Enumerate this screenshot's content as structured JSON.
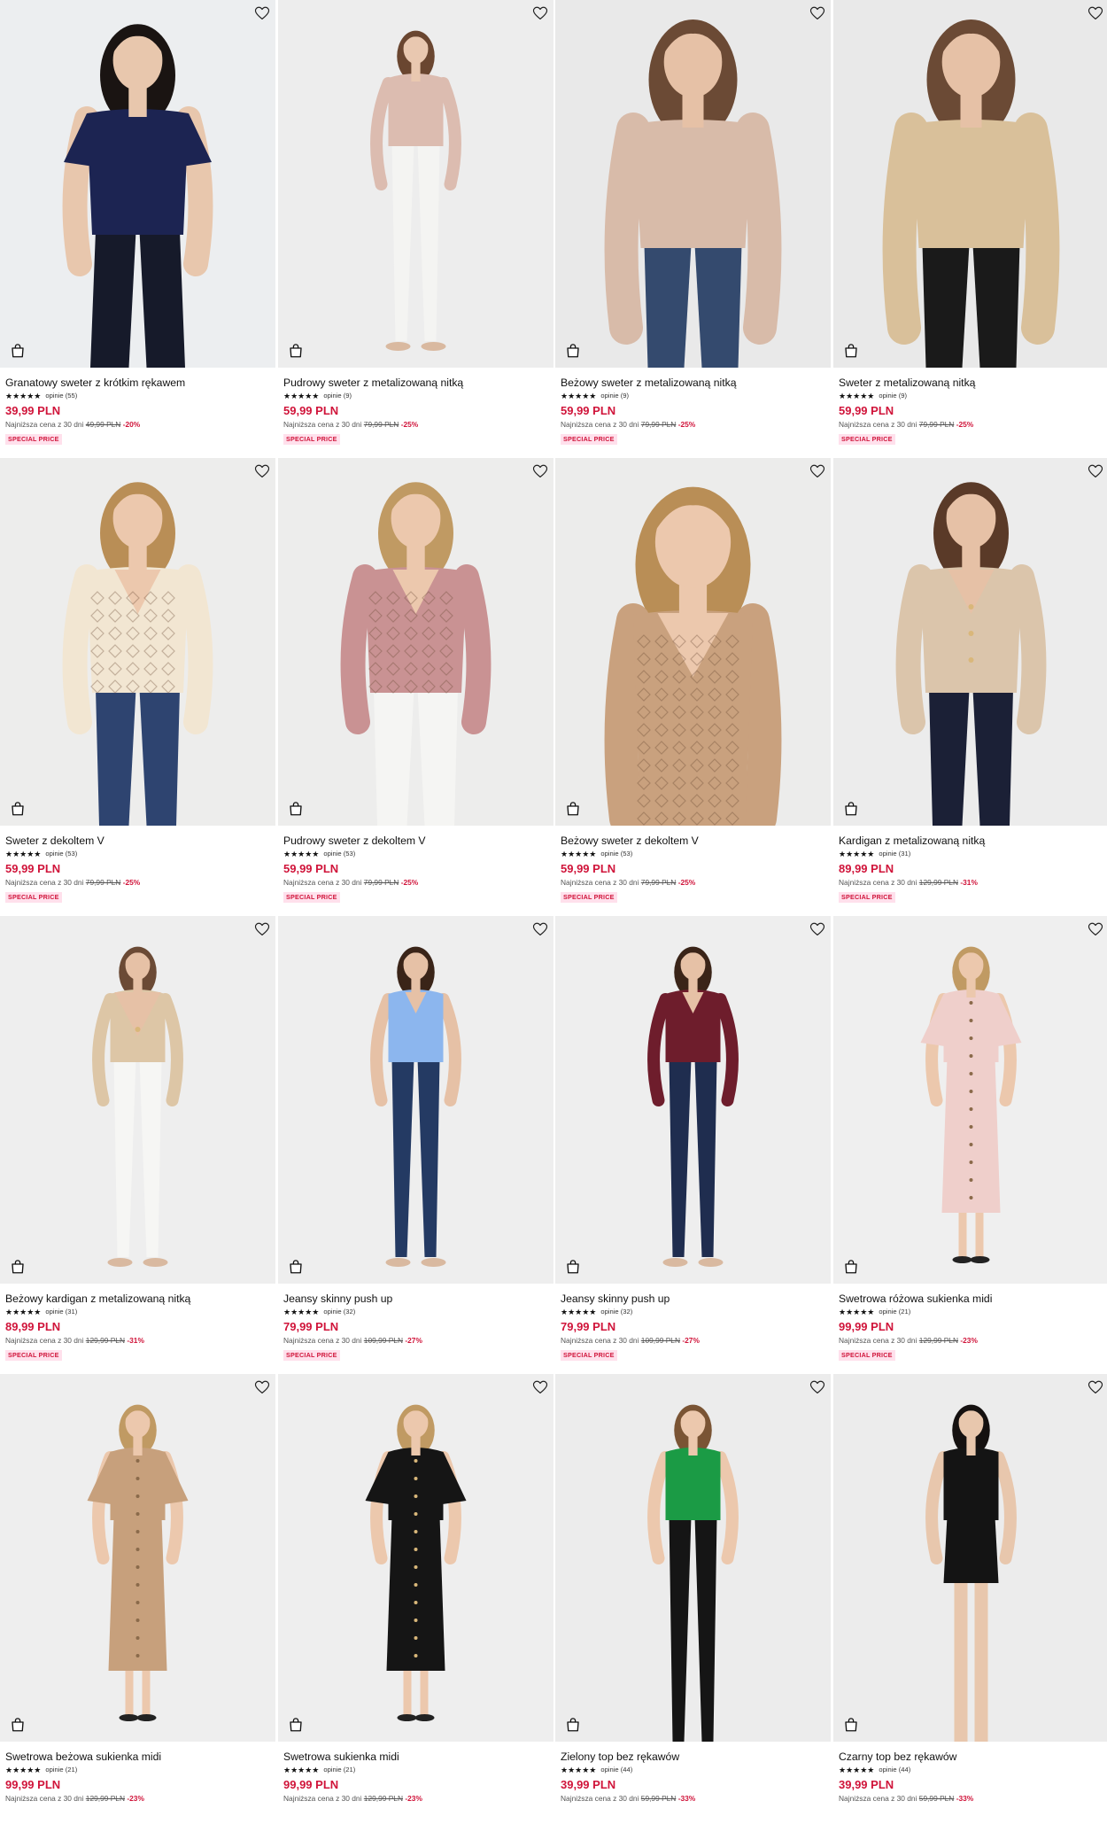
{
  "products": [
    {
      "name": "Granatowy sweter z krótkim rękawem",
      "stars": "★★★★★",
      "reviews": "opinie (55)",
      "price": "39,99 PLN",
      "lowest_label": "Najniższa cena z 30 dni",
      "old_price": "49,99 PLN",
      "discount": "-20%",
      "badge": "SPECIAL PRICE",
      "bg": "#eceef0",
      "top": "#1c2452",
      "bottom": "#161a2a",
      "skin": "#e8c7ad",
      "hair": "#1a1412",
      "style": "tee",
      "legs": "pants-wide"
    },
    {
      "name": "Pudrowy sweter z metalizowaną nitką",
      "stars": "★★★★★",
      "reviews": "opinie (9)",
      "price": "59,99 PLN",
      "lowest_label": "Najniższa cena z 30 dni",
      "old_price": "79,99 PLN",
      "discount": "-25%",
      "badge": "SPECIAL PRICE",
      "bg": "#ededed",
      "top": "#dcbcb0",
      "bottom": "#f4f4f2",
      "skin": "#e9c8b0",
      "hair": "#6a4630",
      "style": "long",
      "legs": "jeans-full"
    },
    {
      "name": "Beżowy sweter z metalizowaną nitką",
      "stars": "★★★★★",
      "reviews": "opinie (9)",
      "price": "59,99 PLN",
      "lowest_label": "Najniższa cena z 30 dni",
      "old_price": "79,99 PLN",
      "discount": "-25%",
      "badge": "SPECIAL PRICE",
      "bg": "#e9e9e9",
      "top": "#d8bba9",
      "bottom": "#344a6e",
      "skin": "#e6c1a6",
      "hair": "#6b4a35",
      "style": "close",
      "legs": "close"
    },
    {
      "name": "Sweter z metalizowaną nitką",
      "stars": "★★★★★",
      "reviews": "opinie (9)",
      "price": "59,99 PLN",
      "lowest_label": "Najniższa cena z 30 dni",
      "old_price": "79,99 PLN",
      "discount": "-25%",
      "badge": "SPECIAL PRICE",
      "bg": "#e9e9e9",
      "top": "#d9c09a",
      "bottom": "#1a1a1a",
      "skin": "#e6c1a6",
      "hair": "#6b4a35",
      "style": "close",
      "legs": "close"
    },
    {
      "name": "Sweter z dekoltem V",
      "stars": "★★★★★",
      "reviews": "opinie (53)",
      "price": "59,99 PLN",
      "lowest_label": "Najniższa cena z 30 dni",
      "old_price": "79,99 PLN",
      "discount": "-25%",
      "badge": "SPECIAL PRICE",
      "bg": "#ededec",
      "top": "#f2e6d2",
      "bottom": "#2e4470",
      "skin": "#ecc8ad",
      "hair": "#b98e56",
      "style": "knit",
      "legs": "close"
    },
    {
      "name": "Pudrowy sweter z dekoltem V",
      "stars": "★★★★★",
      "reviews": "opinie (53)",
      "price": "59,99 PLN",
      "lowest_label": "Najniższa cena z 30 dni",
      "old_price": "79,99 PLN",
      "discount": "-25%",
      "badge": "SPECIAL PRICE",
      "bg": "#ededec",
      "top": "#c99293",
      "bottom": "#f5f5f3",
      "skin": "#ecc8ad",
      "hair": "#c09a63",
      "style": "knit",
      "legs": "close"
    },
    {
      "name": "Beżowy sweter z dekoltem V",
      "stars": "★★★★★",
      "reviews": "opinie (53)",
      "price": "59,99 PLN",
      "lowest_label": "Najniższa cena z 30 dni",
      "old_price": "79,99 PLN",
      "discount": "-25%",
      "badge": "SPECIAL PRICE",
      "bg": "#ececeb",
      "top": "#c9a17e",
      "bottom": "#c9a17e",
      "skin": "#ecc8ad",
      "hair": "#b98e56",
      "style": "knit-big",
      "legs": "none"
    },
    {
      "name": "Kardigan z metalizowaną nitką",
      "stars": "★★★★★",
      "reviews": "opinie (31)",
      "price": "89,99 PLN",
      "lowest_label": "Najniższa cena z 30 dni",
      "old_price": "129,99 PLN",
      "discount": "-31%",
      "badge": "SPECIAL PRICE",
      "bg": "#ececec",
      "top": "#dbc5ab",
      "bottom": "#1b2036",
      "skin": "#e6c1a6",
      "hair": "#5a3a28",
      "style": "cardigan",
      "legs": "close"
    },
    {
      "name": "Beżowy kardigan z metalizowaną nitką",
      "stars": "★★★★★",
      "reviews": "opinie (31)",
      "price": "89,99 PLN",
      "lowest_label": "Najniższa cena z 30 dni",
      "old_price": "129,99 PLN",
      "discount": "-31%",
      "badge": "SPECIAL PRICE",
      "bg": "#eeeeee",
      "top": "#ddc6a6",
      "bottom": "#f6f6f4",
      "skin": "#e6c1a6",
      "hair": "#6b4a35",
      "style": "cardigan-full",
      "legs": "jeans-full"
    },
    {
      "name": "Jeansy skinny push up",
      "stars": "★★★★★",
      "reviews": "opinie (32)",
      "price": "79,99 PLN",
      "lowest_label": "Najniższa cena z 30 dni",
      "old_price": "109,99 PLN",
      "discount": "-27%",
      "badge": "SPECIAL PRICE",
      "bg": "#eeeeee",
      "top": "#8cb6ee",
      "bottom": "#243a63",
      "skin": "#e6c1a6",
      "hair": "#3a2418",
      "style": "tank",
      "legs": "jeans-full"
    },
    {
      "name": "Jeansy skinny push up",
      "stars": "★★★★★",
      "reviews": "opinie (32)",
      "price": "79,99 PLN",
      "lowest_label": "Najniższa cena z 30 dni",
      "old_price": "109,99 PLN",
      "discount": "-27%",
      "badge": "SPECIAL PRICE",
      "bg": "#eeeeee",
      "top": "#6e1d2c",
      "bottom": "#1f2d4f",
      "skin": "#e6c1a6",
      "hair": "#3a2418",
      "style": "blouse",
      "legs": "jeans-full"
    },
    {
      "name": "Swetrowa różowa sukienka midi",
      "stars": "★★★★★",
      "reviews": "opinie (21)",
      "price": "99,99 PLN",
      "lowest_label": "Najniższa cena z 30 dni",
      "old_price": "129,99 PLN",
      "discount": "-23%",
      "badge": "SPECIAL PRICE",
      "bg": "#efefef",
      "top": "#efcfcb",
      "bottom": "#efcfcb",
      "skin": "#ecc8ad",
      "hair": "#c09a63",
      "style": "dress",
      "legs": "dress"
    },
    {
      "name": "Swetrowa beżowa sukienka midi",
      "stars": "★★★★★",
      "reviews": "opinie (21)",
      "price": "99,99 PLN",
      "lowest_label": "Najniższa cena z 30 dni",
      "old_price": "129,99 PLN",
      "discount": "-23%",
      "badge": "",
      "bg": "#eeeeee",
      "top": "#c7a07c",
      "bottom": "#c7a07c",
      "skin": "#ecc8ad",
      "hair": "#c09a63",
      "style": "dress",
      "legs": "dress"
    },
    {
      "name": "Swetrowa sukienka midi",
      "stars": "★★★★★",
      "reviews": "opinie (21)",
      "price": "99,99 PLN",
      "lowest_label": "Najniższa cena z 30 dni",
      "old_price": "129,99 PLN",
      "discount": "-23%",
      "badge": "",
      "bg": "#eeeeee",
      "top": "#151515",
      "bottom": "#151515",
      "skin": "#ecc8ad",
      "hair": "#c09a63",
      "style": "dress",
      "legs": "dress"
    },
    {
      "name": "Zielony top bez rękawów",
      "stars": "★★★★★",
      "reviews": "opinie (44)",
      "price": "39,99 PLN",
      "lowest_label": "Najniższa cena z 30 dni",
      "old_price": "59,99 PLN",
      "discount": "-33%",
      "badge": "",
      "bg": "#ececec",
      "top": "#1b9b45",
      "bottom": "#151515",
      "skin": "#ecc8ad",
      "hair": "#7a5434",
      "style": "sleeveless",
      "legs": "close"
    },
    {
      "name": "Czarny top bez rękawów",
      "stars": "★★★★★",
      "reviews": "opinie (44)",
      "price": "39,99 PLN",
      "lowest_label": "Najniższa cena z 30 dni",
      "old_price": "59,99 PLN",
      "discount": "-33%",
      "badge": "",
      "bg": "#ececec",
      "top": "#141414",
      "bottom": "#141414",
      "skin": "#e8c7ad",
      "hair": "#151110",
      "style": "sleeveless",
      "legs": "shorts"
    }
  ]
}
